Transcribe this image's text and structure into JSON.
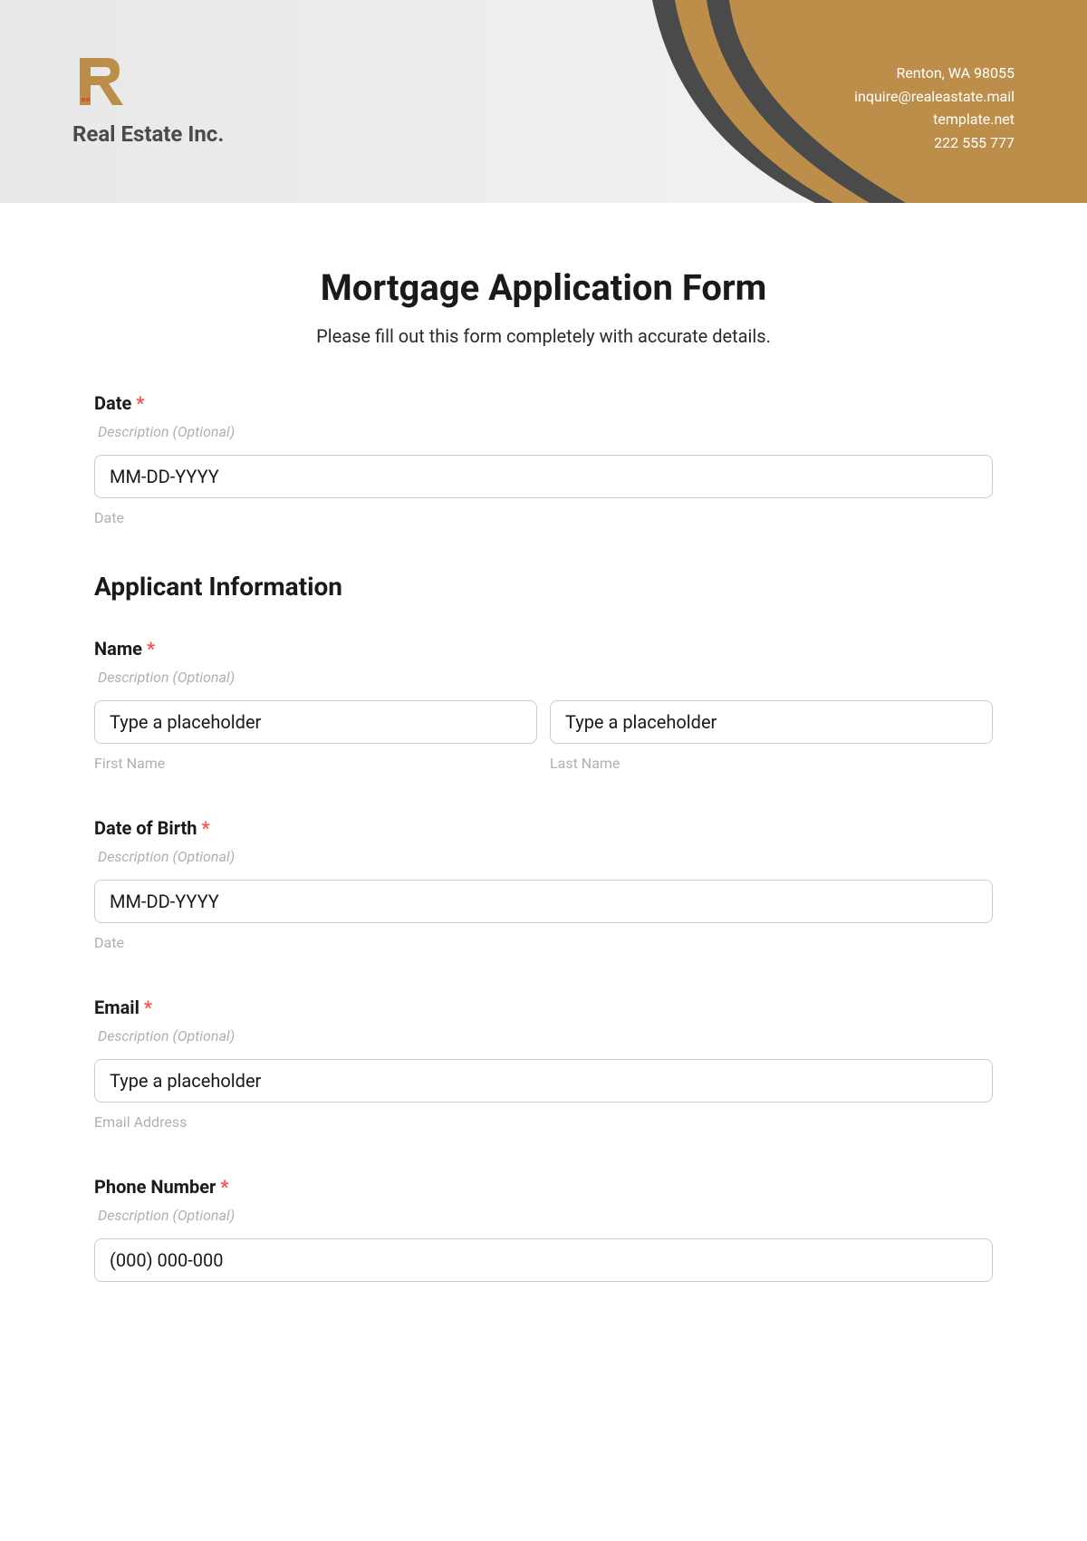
{
  "header": {
    "company_name": "Real Estate Inc.",
    "contact": {
      "address": "Renton, WA 98055",
      "email": "inquire@realeastate.mail",
      "website": "template.net",
      "phone": "222 555 777"
    }
  },
  "form": {
    "title": "Mortgage Application Form",
    "subtitle": "Please fill out this form completely with accurate details.",
    "description_placeholder": "Description (Optional)",
    "fields": {
      "date": {
        "label": "Date",
        "placeholder": "MM-DD-YYYY",
        "sublabel": "Date"
      },
      "applicant_section": "Applicant Information",
      "name": {
        "label": "Name",
        "first_placeholder": "Type a placeholder",
        "last_placeholder": "Type a placeholder",
        "first_sublabel": "First Name",
        "last_sublabel": "Last Name"
      },
      "dob": {
        "label": "Date of Birth",
        "placeholder": "MM-DD-YYYY",
        "sublabel": "Date"
      },
      "email": {
        "label": "Email",
        "placeholder": "Type a placeholder",
        "sublabel": "Email Address"
      },
      "phone": {
        "label": "Phone Number",
        "placeholder": "(000) 000-000"
      }
    }
  }
}
